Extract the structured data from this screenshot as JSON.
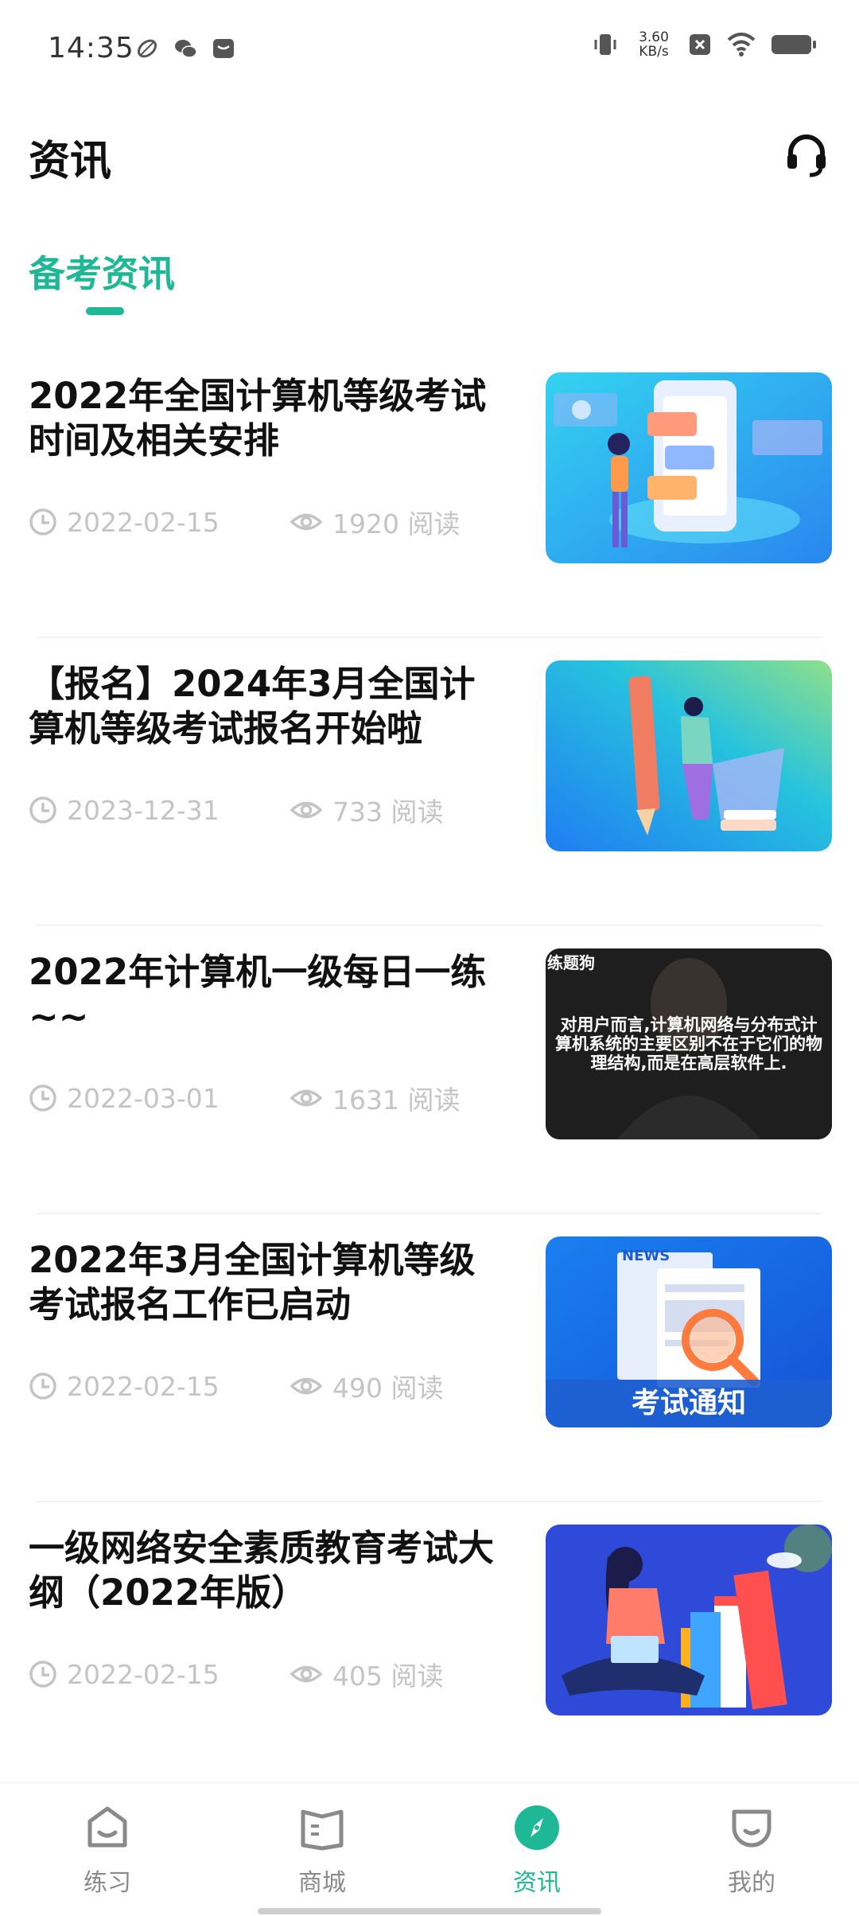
{
  "status_bar": {
    "time": "14:35",
    "speed": "3.60",
    "speed_unit": "KB/s",
    "icons": [
      "leaf-icon",
      "wechat-icon",
      "message-box-icon",
      "vibrate-icon",
      "close-box-icon",
      "wifi-icon",
      "battery-icon"
    ]
  },
  "header": {
    "title": "资讯",
    "support_icon": "headset-icon"
  },
  "tabs": [
    {
      "label": "备考资讯",
      "active": true
    }
  ],
  "articles": [
    {
      "title": "2022年全国计算机等级考试时间及相关安排",
      "date": "2022-02-15",
      "views": "1920 阅读",
      "thumb_icon": "phone-illustration"
    },
    {
      "title": "【报名】2024年3月全国计算机等级考试报名开始啦",
      "date": "2023-12-31",
      "views": "733 阅读",
      "thumb_icon": "pencil-illustration"
    },
    {
      "title": "2022年计算机一级每日一练~~",
      "date": "2022-03-01",
      "views": "1631 阅读",
      "thumb_icon": "video-thumbnail",
      "thumb_text": "对用户而言,计算机网络与分布式计算机系统的主要区别不在于它们的物理结构,而是在高层软件上.",
      "thumb_brand": "练题狗"
    },
    {
      "title": "2022年3月全国计算机等级考试报名工作已启动",
      "date": "2022-02-15",
      "views": "490 阅读",
      "thumb_icon": "news-illustration",
      "thumb_text": "考试通知",
      "thumb_badge": "NEWS"
    },
    {
      "title": "一级网络安全素质教育考试大纲（2022年版）",
      "date": "2022-02-15",
      "views": "405 阅读",
      "thumb_icon": "books-illustration"
    }
  ],
  "bottom_nav": [
    {
      "label": "练习",
      "icon": "practice-icon",
      "active": false
    },
    {
      "label": "商城",
      "icon": "book-icon",
      "active": false
    },
    {
      "label": "资讯",
      "icon": "compass-icon",
      "active": true
    },
    {
      "label": "我的",
      "icon": "profile-icon",
      "active": false
    }
  ],
  "colors": {
    "accent": "#1fb897",
    "meta_text": "#c4c4c4",
    "nav_text": "#8a8a8a"
  }
}
